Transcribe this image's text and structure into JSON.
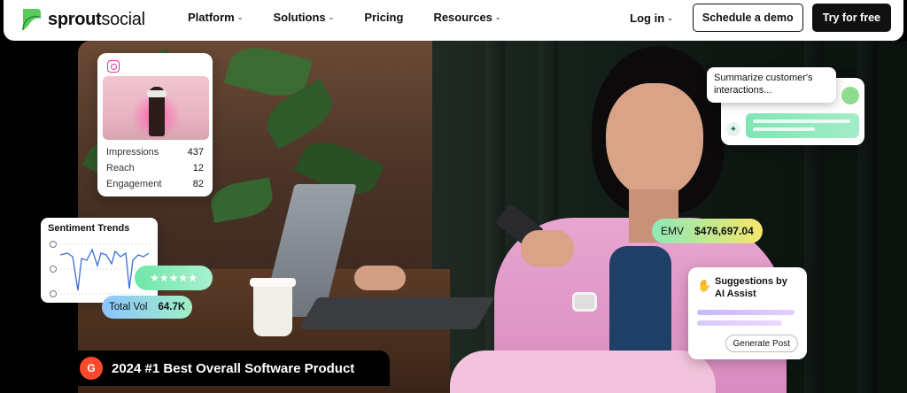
{
  "nav": {
    "logo_bold": "sprout",
    "logo_light": "social",
    "links": [
      "Platform",
      "Solutions",
      "Pricing",
      "Resources"
    ],
    "login": "Log in",
    "demo": "Schedule a demo",
    "try": "Try for free",
    "chevron": "⌄"
  },
  "instagram_card": {
    "icon": "instagram-icon",
    "stats": [
      {
        "label": "Impressions",
        "value": "437"
      },
      {
        "label": "Reach",
        "value": "12"
      },
      {
        "label": "Engagement",
        "value": "82"
      }
    ]
  },
  "sentiment": {
    "title": "Sentiment Trends",
    "total_vol_label": "Total Vol",
    "total_vol_value": "64.7K",
    "stars": "★★★★★"
  },
  "chat": {
    "prompt": "Summarize customer's interactions..."
  },
  "emv": {
    "label": "EMV",
    "value": "$476,697.04"
  },
  "ai": {
    "title": "Suggestions by AI Assist",
    "button": "Generate Post"
  },
  "award": {
    "badge": "G",
    "text": "2024 #1 Best Overall Software Product"
  },
  "colors": {
    "brand_green": "#59cb59",
    "g2_red": "#ff492c",
    "pink": "#e0339b"
  }
}
